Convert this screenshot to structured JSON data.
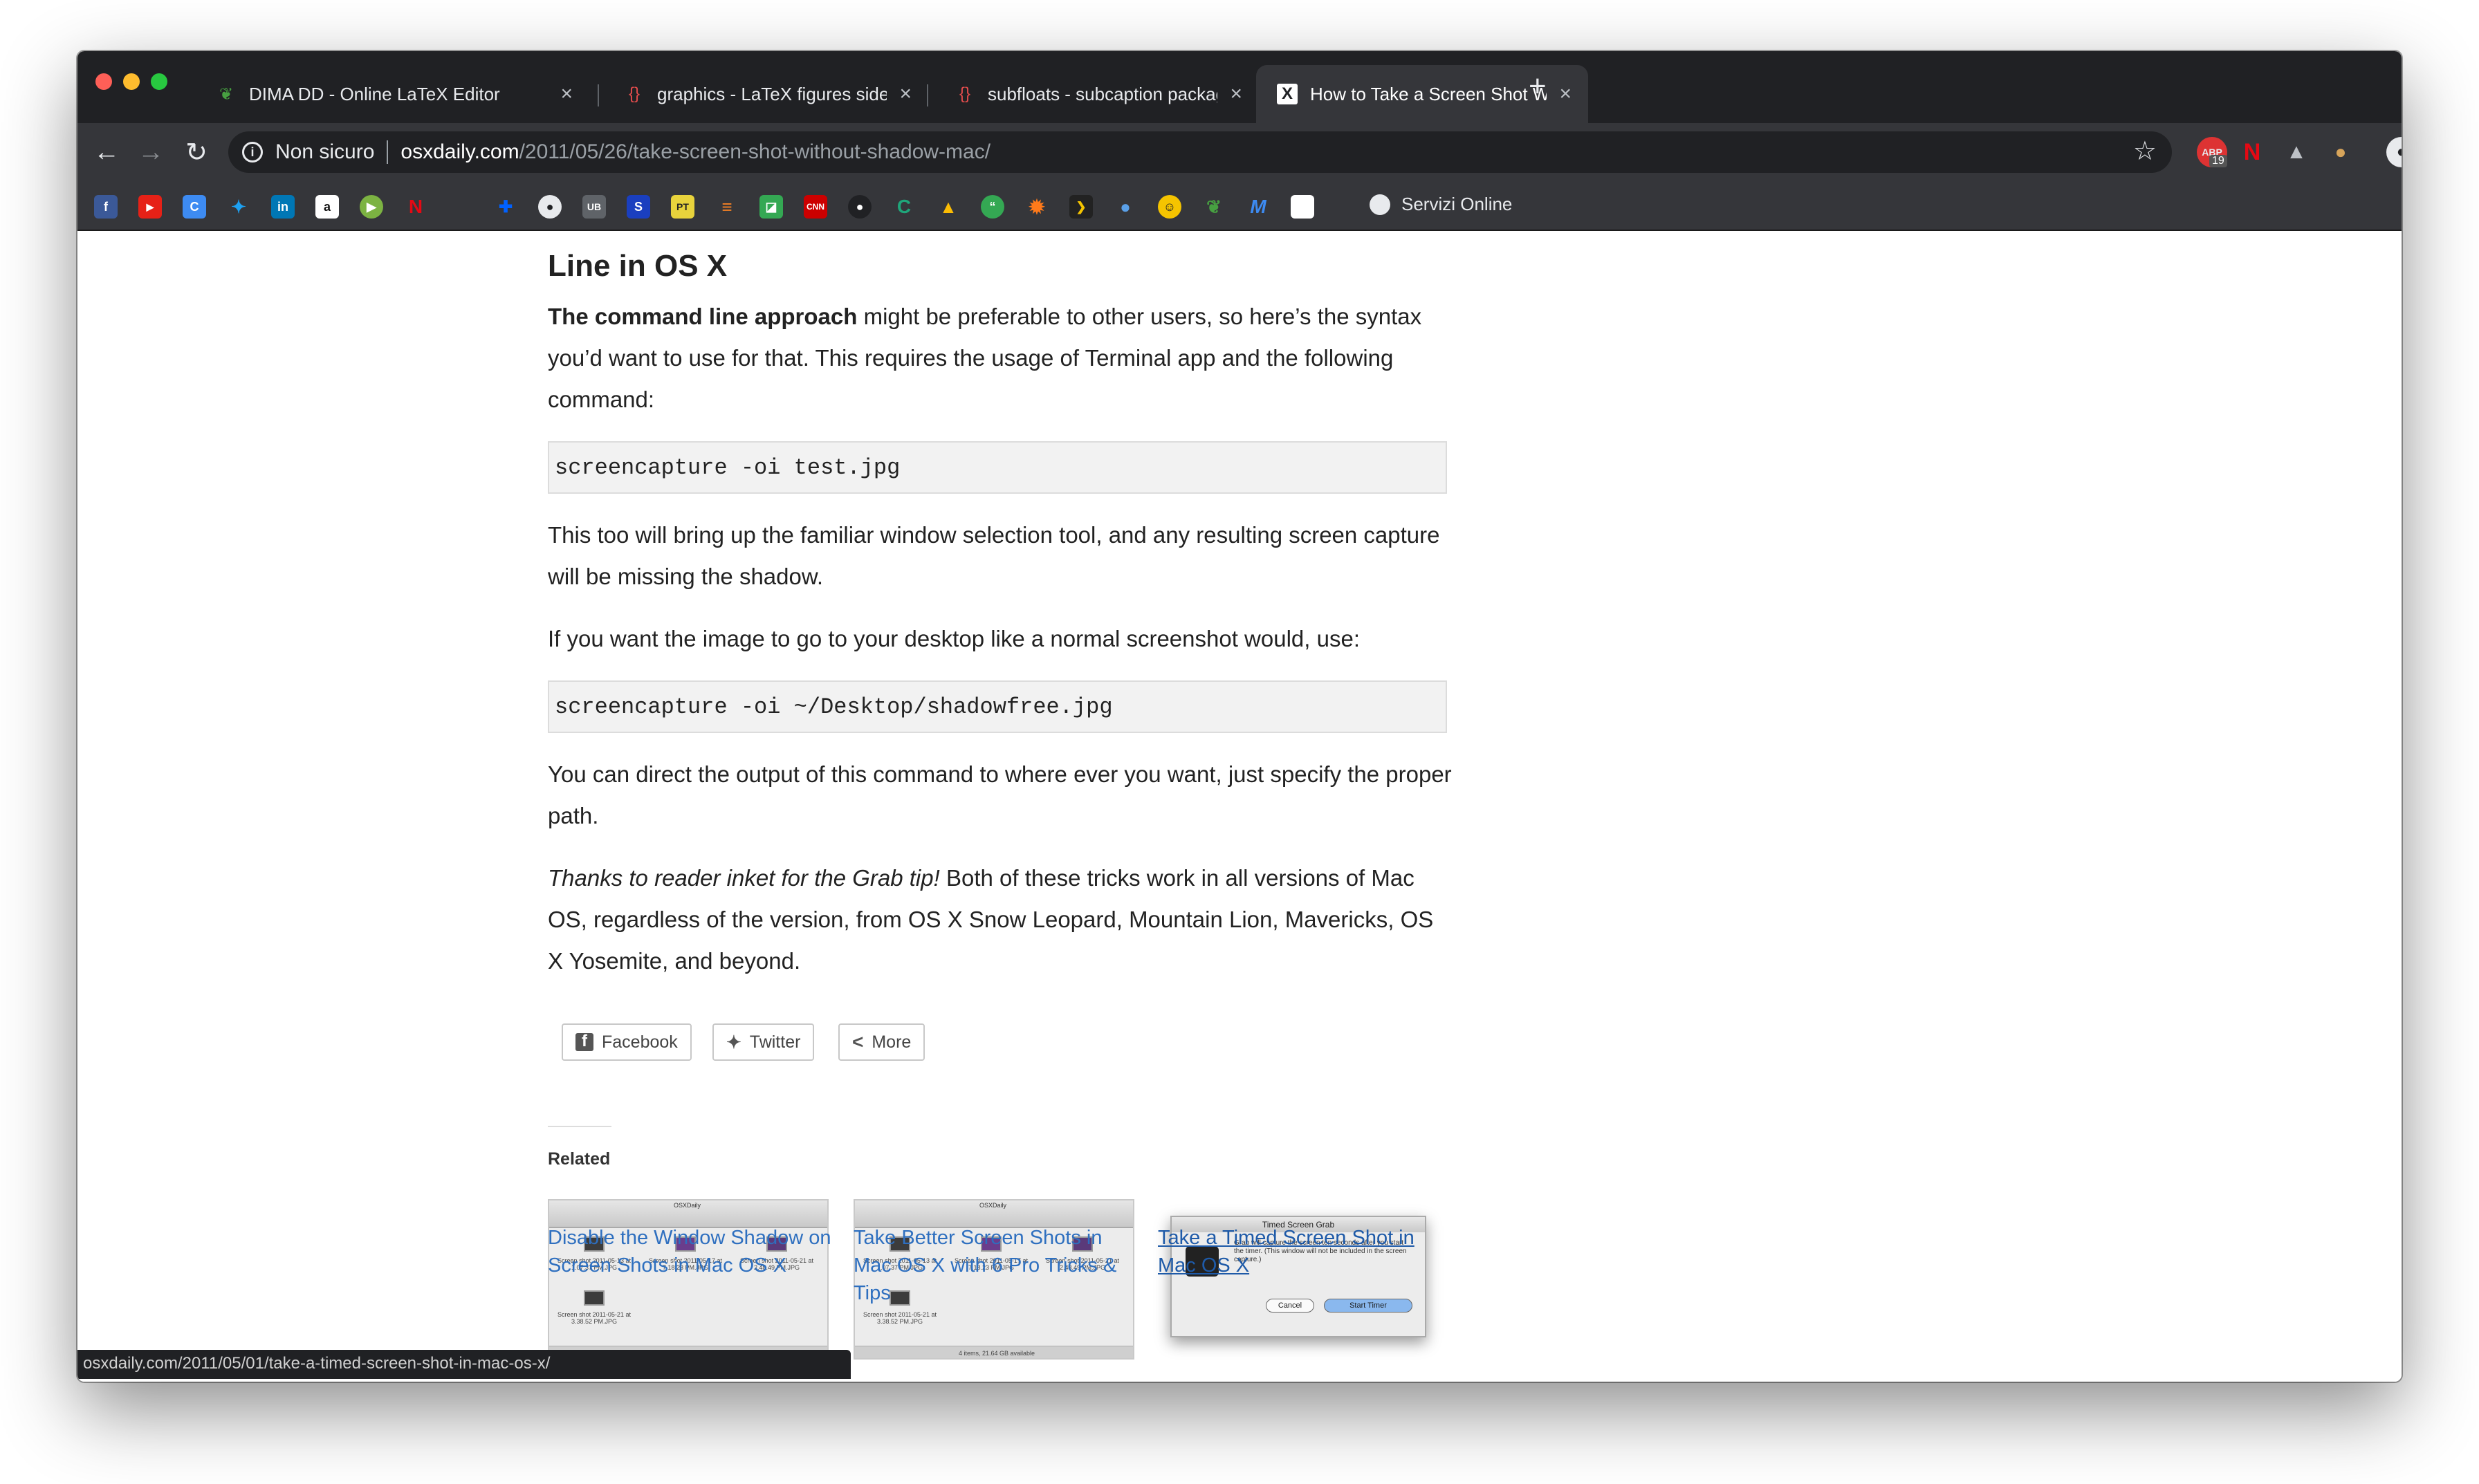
{
  "tabs": [
    {
      "title": "DIMA DD - Online LaTeX Editor",
      "favicon": "overleaf-icon",
      "active": false
    },
    {
      "title": "graphics - LaTeX figures side by side",
      "favicon": "tex-stackexchange-icon",
      "active": false
    },
    {
      "title": "subfloats - subcaption package",
      "favicon": "tex-stackexchange-icon",
      "active": false
    },
    {
      "title": "How to Take a Screen Shot Without Shadow",
      "favicon": "osxdaily-icon",
      "active": true
    }
  ],
  "new_tab_label": "+",
  "address": {
    "security": "Non sicuro",
    "domain": "osxdaily.com",
    "path": "/2011/05/26/take-screen-shot-without-shadow-mac/"
  },
  "extensions": {
    "badge": "19"
  },
  "bookmarks": {
    "text_item": "Servizi Online"
  },
  "article": {
    "heading_partial": "Line in OS X",
    "p1_bold": "The command line approach",
    "p1_rest": " might be preferable to other users, so here’s the syntax you’d want to use for that. This requires the usage of Terminal app and the following command:",
    "code1": "screencapture -oi test.jpg",
    "p2": "This too will bring up the familiar window selection tool, and any resulting screen capture will be missing the shadow.",
    "p3": "If you want the image to go to your desktop like a normal screenshot would, use:",
    "code2": "screencapture -oi ~/Desktop/shadowfree.jpg",
    "p4": "You can direct the output of this command to where ever you want, just specify the proper path.",
    "p5_italic": "Thanks to reader inket for the Grab tip!",
    "p5_rest": " Both of these tricks work in all versions of Mac OS, regardless of the version, from OS X Snow Leopard, Mountain Lion, Mavericks, OS X Yosemite, and beyond."
  },
  "share": {
    "facebook": "Facebook",
    "twitter": "Twitter",
    "more": "More"
  },
  "related": {
    "heading": "Related",
    "items": [
      {
        "title": "Disable the Window Shadow on Screen Shots in Mac OS X"
      },
      {
        "title": "Take Better Screen Shots in Mac OS X with 6 Pro Tricks & Tips"
      },
      {
        "title": "Take a Timed Screen Shot in Mac OS X"
      }
    ],
    "dialog": {
      "title": "Timed Screen Grab",
      "text": "Grab will capture the screen ten seconds after you start the timer. (This window will not be included in the screen capture.)",
      "cancel": "Cancel",
      "start": "Start Timer"
    },
    "finder": {
      "window_title": "OSXDaily",
      "files": [
        "Screen shot 2011-05-13 at 1.07.37 PM.JPG",
        "Screen shot 2011-05-17 at 7.18.23 PM.JPG",
        "Screen shot 2011-05-21 at 2.48.49 PM.JPG",
        "Screen shot 2011-05-21 at 3.38.52 PM.JPG"
      ],
      "status": "4 items, 21.64 GB available"
    }
  },
  "status_url": "osxdaily.com/2011/05/01/take-a-timed-screen-shot-in-mac-os-x/",
  "colors": {
    "chrome_dark": "#202124",
    "chrome_toolbar": "#35363a",
    "link": "#2e6fbf"
  }
}
